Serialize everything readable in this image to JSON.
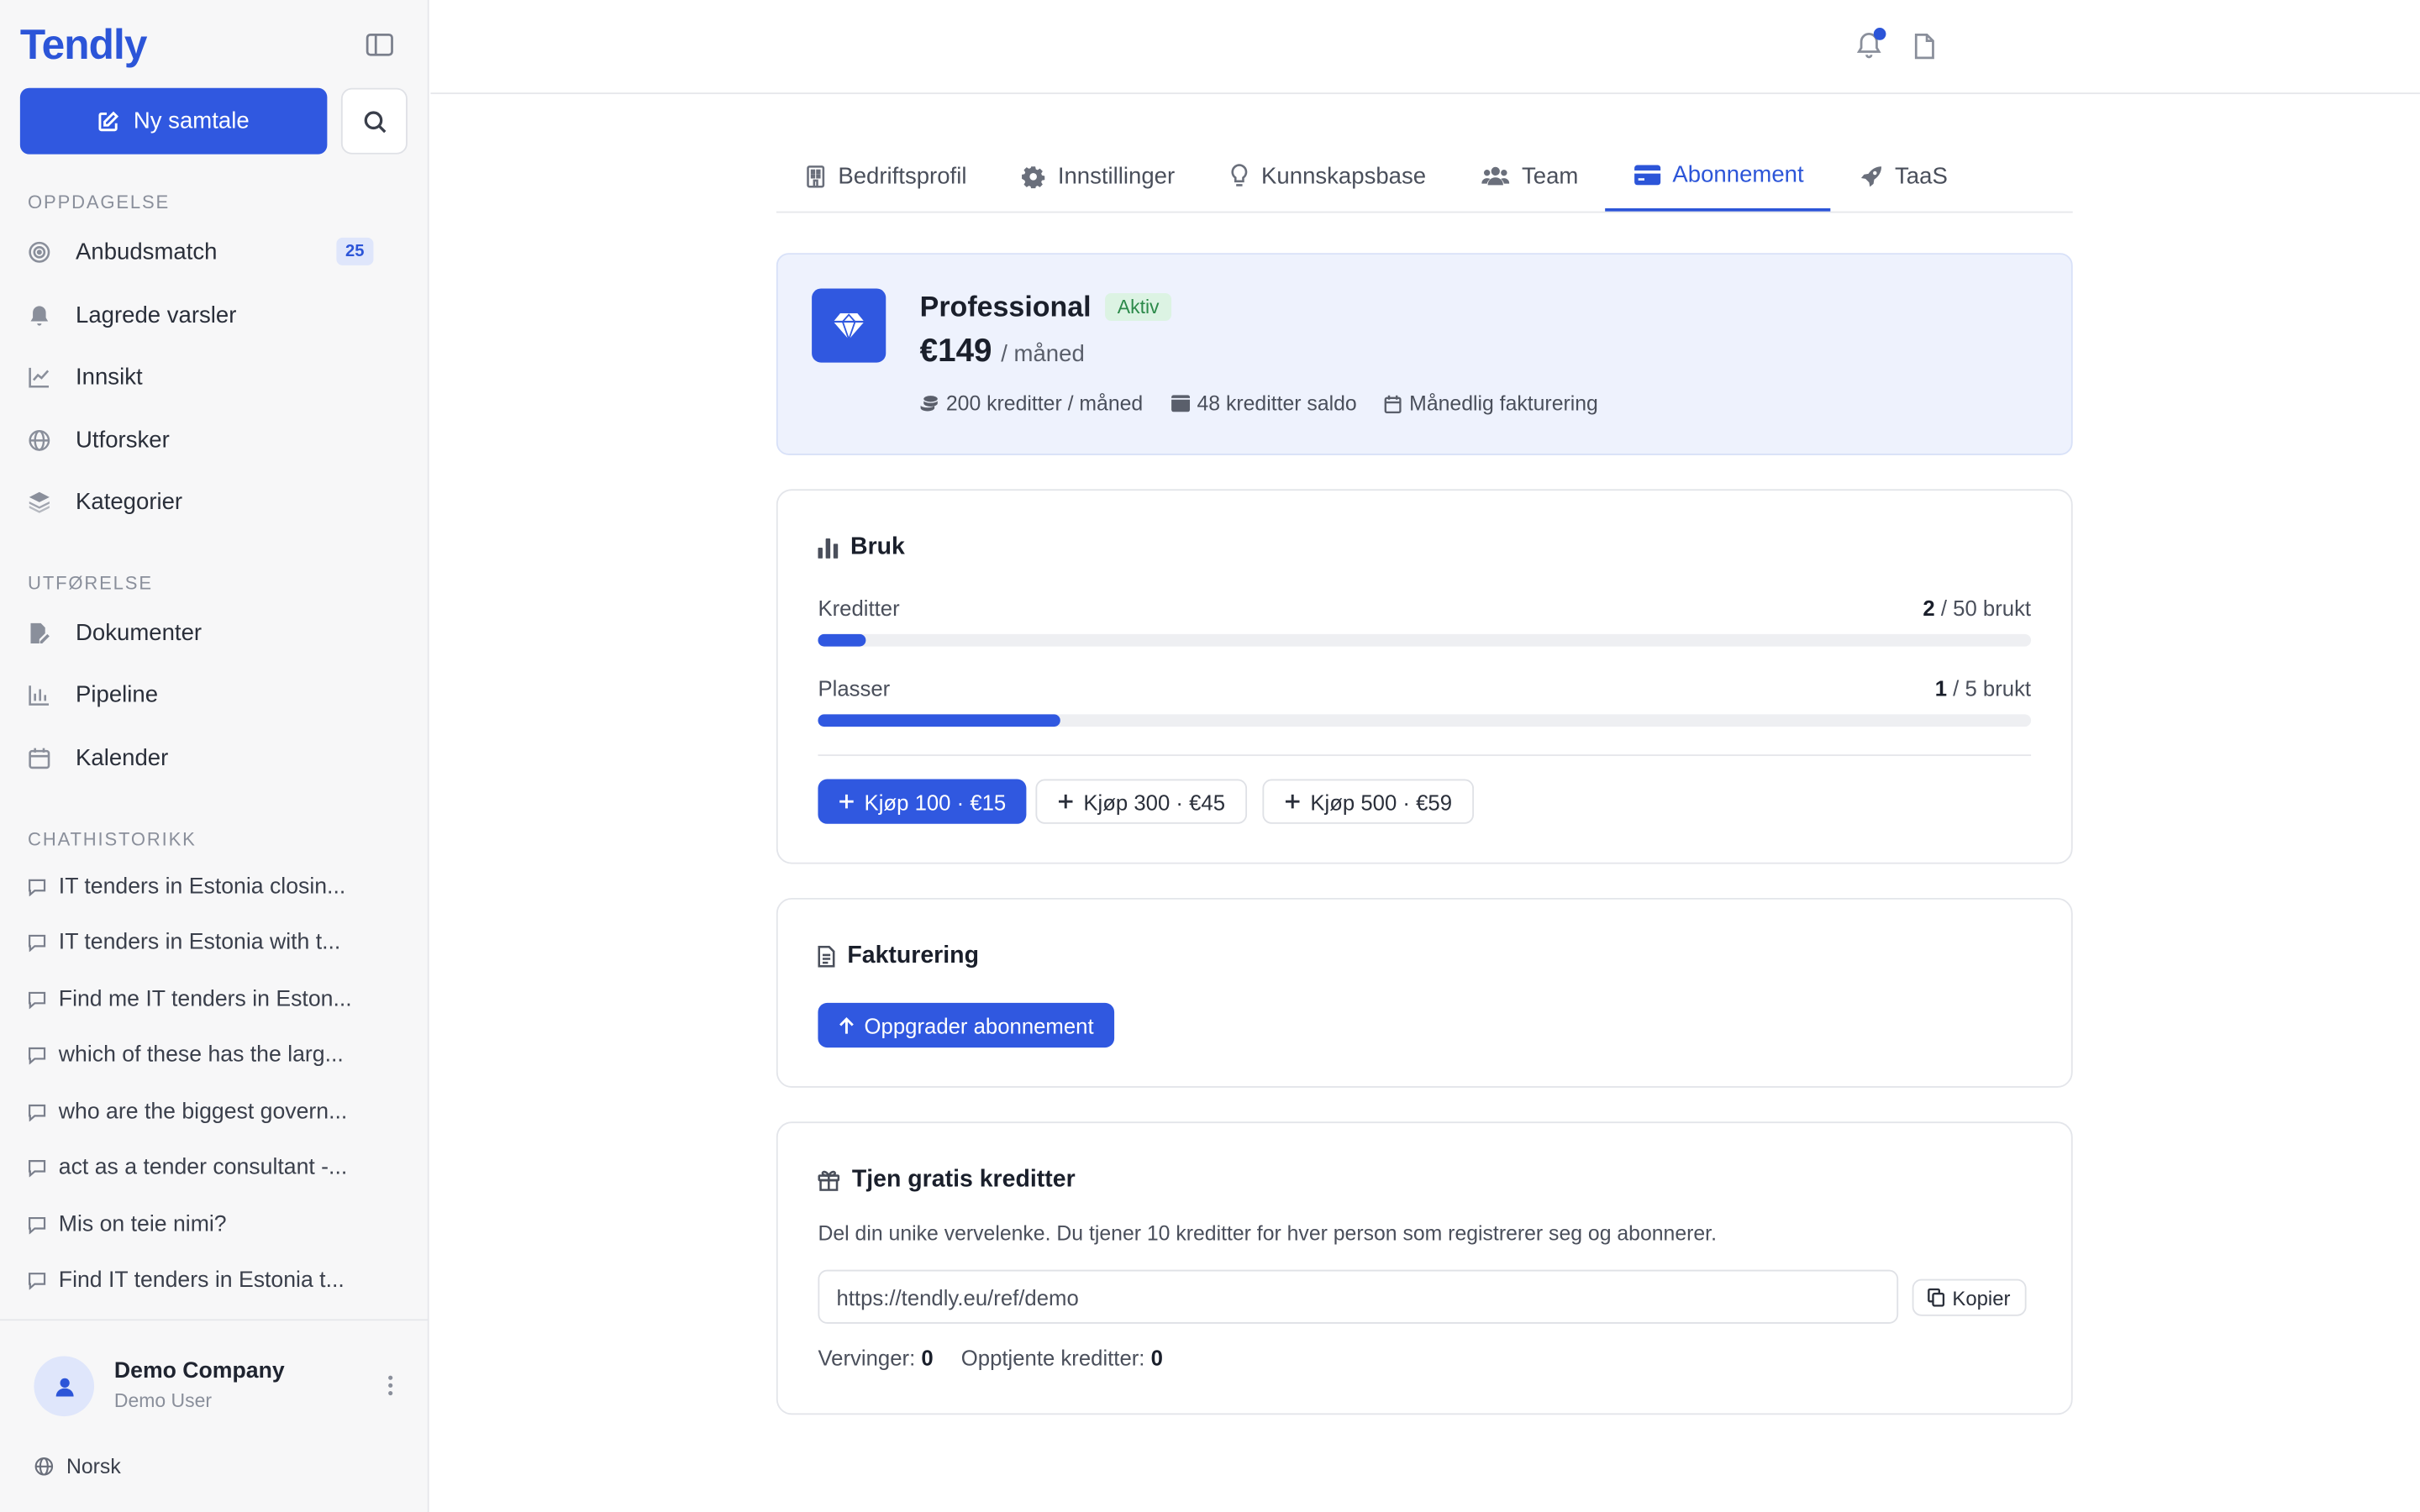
{
  "app": {
    "logo": "Tendly"
  },
  "sidebar": {
    "new_chat_label": "Ny samtale",
    "sections": {
      "discovery": "OPPDAGELSE",
      "execution": "UTFØRELSE",
      "history": "CHATHISTORIKK"
    },
    "discovery_items": [
      {
        "label": "Anbudsmatch",
        "icon": "target-icon",
        "badge": "25"
      },
      {
        "label": "Lagrede varsler",
        "icon": "bell-icon"
      },
      {
        "label": "Innsikt",
        "icon": "line-chart-icon"
      },
      {
        "label": "Utforsker",
        "icon": "globe-icon"
      },
      {
        "label": "Kategorier",
        "icon": "layers-icon"
      }
    ],
    "execution_items": [
      {
        "label": "Dokumenter",
        "icon": "file-edit-icon"
      },
      {
        "label": "Pipeline",
        "icon": "bar-chart-icon"
      },
      {
        "label": "Kalender",
        "icon": "calendar-icon"
      }
    ],
    "history_items": [
      "IT tenders in Estonia closin...",
      "IT tenders in Estonia with t...",
      "Find me IT tenders in Eston...",
      "which of these has the larg...",
      "who are the biggest govern...",
      "act as a tender consultant -...",
      "Mis on teie nimi?",
      "Find IT tenders in Estonia t..."
    ],
    "company": "Demo Company",
    "user": "Demo User",
    "language": "Norsk"
  },
  "tabs": [
    {
      "label": "Bedriftsprofil",
      "icon": "building-icon"
    },
    {
      "label": "Innstillinger",
      "icon": "gear-icon"
    },
    {
      "label": "Kunnskapsbase",
      "icon": "lightbulb-icon"
    },
    {
      "label": "Team",
      "icon": "users-icon"
    },
    {
      "label": "Abonnement",
      "icon": "credit-card-icon",
      "active": true
    },
    {
      "label": "TaaS",
      "icon": "rocket-icon"
    }
  ],
  "plan": {
    "name": "Professional",
    "status": "Aktiv",
    "price": "€149",
    "period": "/ måned",
    "credits_per_month": "200 kreditter / måned",
    "credit_balance": "48 kreditter saldo",
    "billing": "Månedlig fakturering"
  },
  "usage": {
    "title": "Bruk",
    "credits": {
      "label": "Kreditter",
      "used": "2",
      "rest": "/ 50 brukt",
      "fraction": 0.04
    },
    "seats": {
      "label": "Plasser",
      "used": "1",
      "rest": "/ 5 brukt",
      "fraction": 0.2
    },
    "buy": [
      "Kjøp 100 · €15",
      "Kjøp 300 · €45",
      "Kjøp 500 · €59"
    ]
  },
  "billing": {
    "title": "Fakturering",
    "upgrade_label": "Oppgrader abonnement"
  },
  "referral": {
    "title": "Tjen gratis kreditter",
    "description": "Del din unike vervelenke. Du tjener 10 kreditter for hver person som registrerer seg og abonnerer.",
    "link": "https://tendly.eu/ref/demo",
    "copy_label": "Kopier",
    "referrals_label": "Vervinger:",
    "referrals_value": "0",
    "earned_label": "Opptjente kreditter:",
    "earned_value": "0"
  },
  "colors": {
    "accent": "#3058e0",
    "active_badge": "#dcf3e3"
  }
}
